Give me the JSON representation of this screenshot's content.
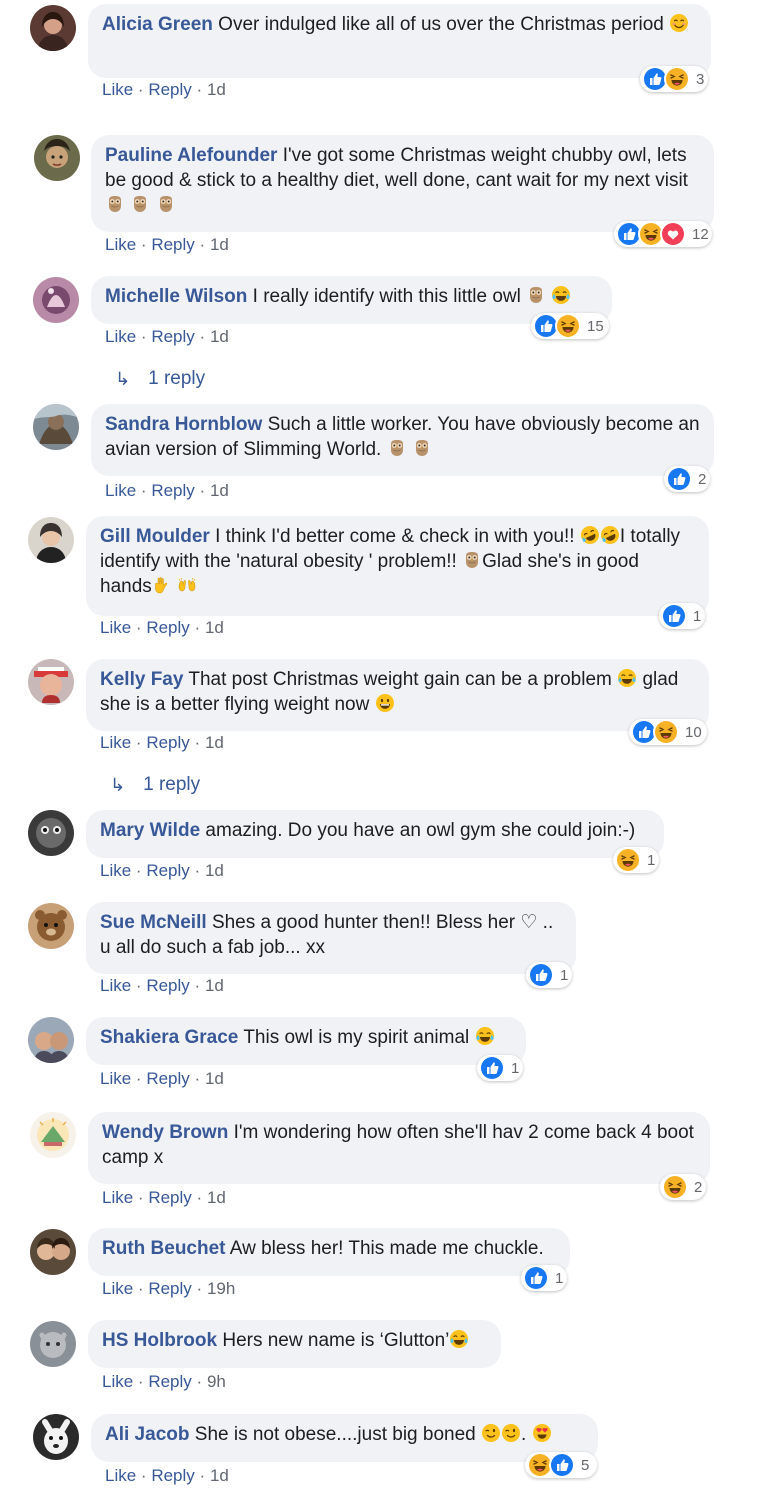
{
  "comments": [
    {
      "name": "Alicia Green",
      "text": "Over indulged like all of us over the Christmas period",
      "emojis_tail": [
        "smile-blush"
      ],
      "like": "Like",
      "reply": "Reply",
      "time": "1d",
      "count": "3",
      "reactions": [
        "like",
        "haha"
      ]
    },
    {
      "name": "Pauline Alefounder",
      "text": "I've got some Christmas weight chubby owl, lets be good & stick to a healthy diet, well done, cant wait for my next visit",
      "emojis_tail": [
        "owl",
        "owl",
        "owl"
      ],
      "like": "Like",
      "reply": "Reply",
      "time": "1d",
      "count": "12",
      "reactions": [
        "like",
        "haha",
        "love"
      ]
    },
    {
      "name": "Michelle Wilson",
      "text": "I really identify with this little owl",
      "emojis_tail": [
        "owl",
        "tears-of-joy"
      ],
      "like": "Like",
      "reply": "Reply",
      "time": "1d",
      "count": "15",
      "reactions": [
        "like",
        "haha"
      ],
      "replies": "1 reply"
    },
    {
      "name": "Sandra Hornblow",
      "text": "Such a little worker. You have obviously become an avian version of Slimming World.",
      "emojis_tail": [
        "owl",
        "owl"
      ],
      "like": "Like",
      "reply": "Reply",
      "time": "1d",
      "count": "2",
      "reactions": [
        "like"
      ]
    },
    {
      "name": "Gill Moulder",
      "text_a": "I think I'd better come & check in with you!!",
      "text_b": "I totally identify with the 'natural obesity ' problem!!",
      "text_c": "Glad she's in good hands",
      "like": "Like",
      "reply": "Reply",
      "time": "1d",
      "count": "1",
      "reactions": [
        "like"
      ]
    },
    {
      "name": "Kelly Fay",
      "text_a": "That post Christmas weight gain can be a problem",
      "text_b": "glad she is a better flying weight now",
      "like": "Like",
      "reply": "Reply",
      "time": "1d",
      "count": "10",
      "reactions": [
        "like",
        "haha"
      ],
      "replies": "1 reply"
    },
    {
      "name": "Mary Wilde",
      "text": "amazing. Do you have an owl gym she could join:-)",
      "like": "Like",
      "reply": "Reply",
      "time": "1d",
      "count": "1",
      "reactions": [
        "haha"
      ]
    },
    {
      "name": "Sue McNeill",
      "text": "Shes a good hunter then!! Bless her ♡ .. u all do such a fab job... xx",
      "like": "Like",
      "reply": "Reply",
      "time": "1d",
      "count": "1",
      "reactions": [
        "like"
      ]
    },
    {
      "name": "Shakiera Grace",
      "text": "This owl is my spirit animal",
      "like": "Like",
      "reply": "Reply",
      "time": "1d",
      "count": "1",
      "reactions": [
        "like"
      ]
    },
    {
      "name": "Wendy Brown",
      "text": "I'm wondering how often she'll hav 2 come back 4 boot camp x",
      "like": "Like",
      "reply": "Reply",
      "time": "1d",
      "count": "2",
      "reactions": [
        "haha"
      ]
    },
    {
      "name": "Ruth Beuchet",
      "text": "Aw bless her! This made me chuckle.",
      "like": "Like",
      "reply": "Reply",
      "time": "19h",
      "count": "1",
      "reactions": [
        "like"
      ]
    },
    {
      "name": "HS Holbrook",
      "text": "Hers new name is ‘Glutton’",
      "like": "Like",
      "reply": "Reply",
      "time": "9h"
    },
    {
      "name": "Ali Jacob",
      "text": "She is not obese....just big boned",
      "text_dot": ".",
      "like": "Like",
      "reply": "Reply",
      "time": "1d",
      "count": "5",
      "reactions": [
        "haha",
        "like"
      ]
    }
  ],
  "separator": "·",
  "colors": {
    "name": "#385898",
    "bubble": "#f0f2f5",
    "meta": "#616770",
    "like": "#1877f2",
    "haha": "#f7b125",
    "love": "#f33e58"
  }
}
